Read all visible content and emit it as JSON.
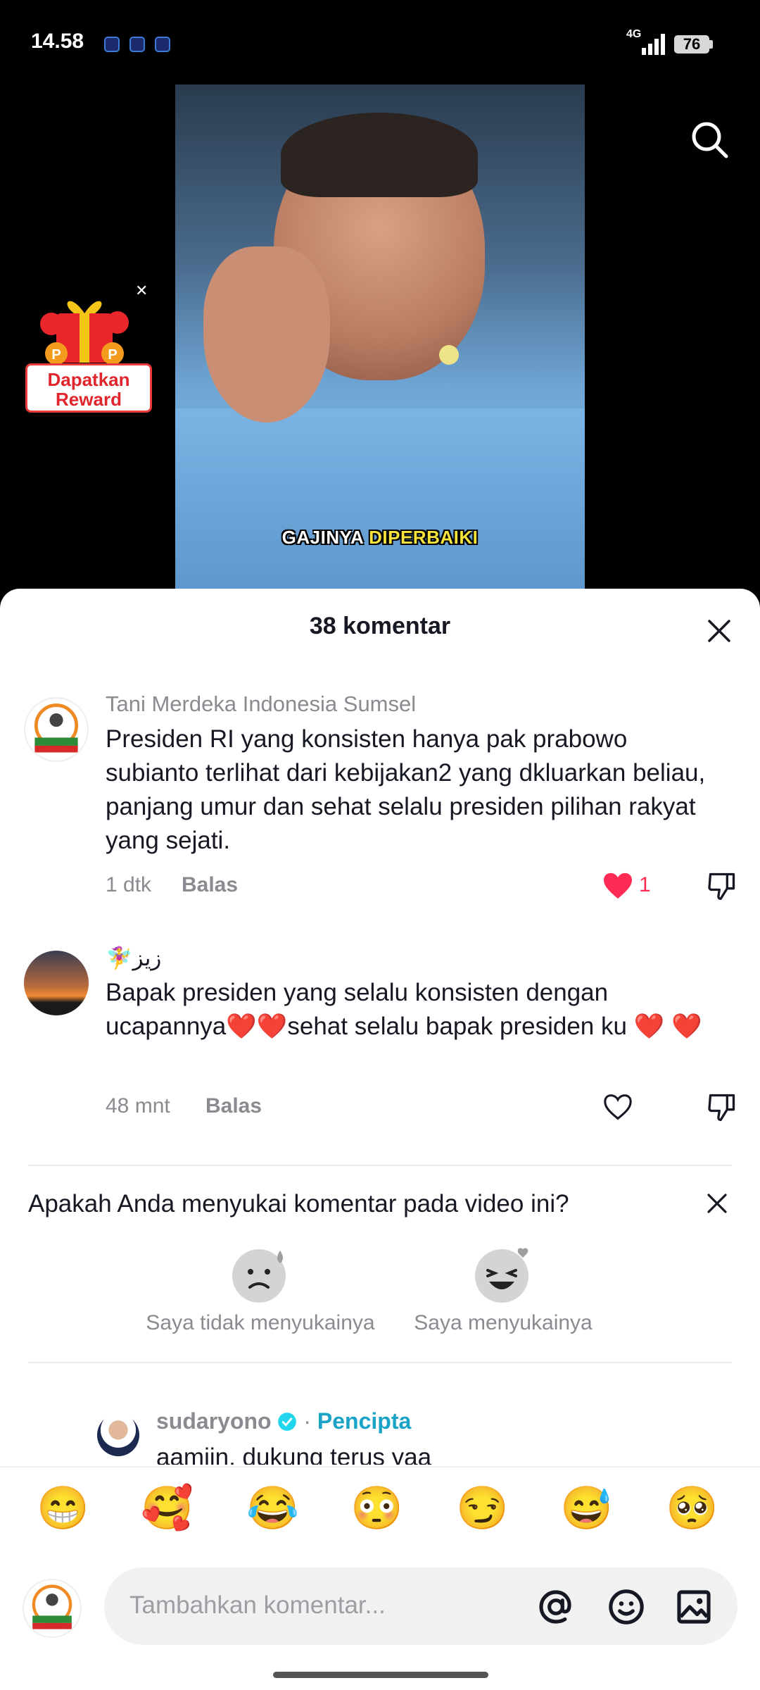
{
  "status_bar": {
    "time": "14.58",
    "network": "4G",
    "battery": "76"
  },
  "video": {
    "caption_white": "GAJINYA",
    "caption_yellow": "DIPERBAIKI"
  },
  "reward": {
    "label_line1": "Dapatkan",
    "label_line2": "Reward"
  },
  "sheet": {
    "title": "38 komentar"
  },
  "comments": [
    {
      "author": "Tani Merdeka Indonesia Sumsel",
      "avatar_text": "TANI MERDEKA INDONESIA",
      "text": "Presiden RI yang konsisten hanya pak prabowo subianto terlihat dari kebijakan2 yang dkluarkan beliau, panjang umur dan sehat selalu presiden pilihan rakyat yang sejati.",
      "time": "1 dtk",
      "reply_label": "Balas",
      "likes": "1",
      "liked": true
    },
    {
      "author": "🧚‍♀️زيز",
      "text": "Bapak presiden yang selalu konsisten dengan ucapannya❤️❤️sehat selalu bapak presiden ku ❤️ ❤️",
      "time": "48 mnt",
      "reply_label": "Balas",
      "liked": false
    }
  ],
  "survey": {
    "question": "Apakah Anda menyukai komentar pada video ini?",
    "dislike_label": "Saya tidak menyukainya",
    "like_label": "Saya menyukainya"
  },
  "creator_reply": {
    "author": "sudaryono",
    "separator": "·",
    "badge": "Pencipta",
    "text": "aamiin, dukung terus yaa"
  },
  "emoji_bar": [
    "😁",
    "🥰",
    "😂",
    "😳",
    "😏",
    "😅",
    "🥺"
  ],
  "input": {
    "placeholder": "Tambahkan komentar..."
  },
  "colors": {
    "accent": "#fe2c55",
    "creator_badge": "#1aa3c7",
    "verified": "#20d5ec"
  }
}
